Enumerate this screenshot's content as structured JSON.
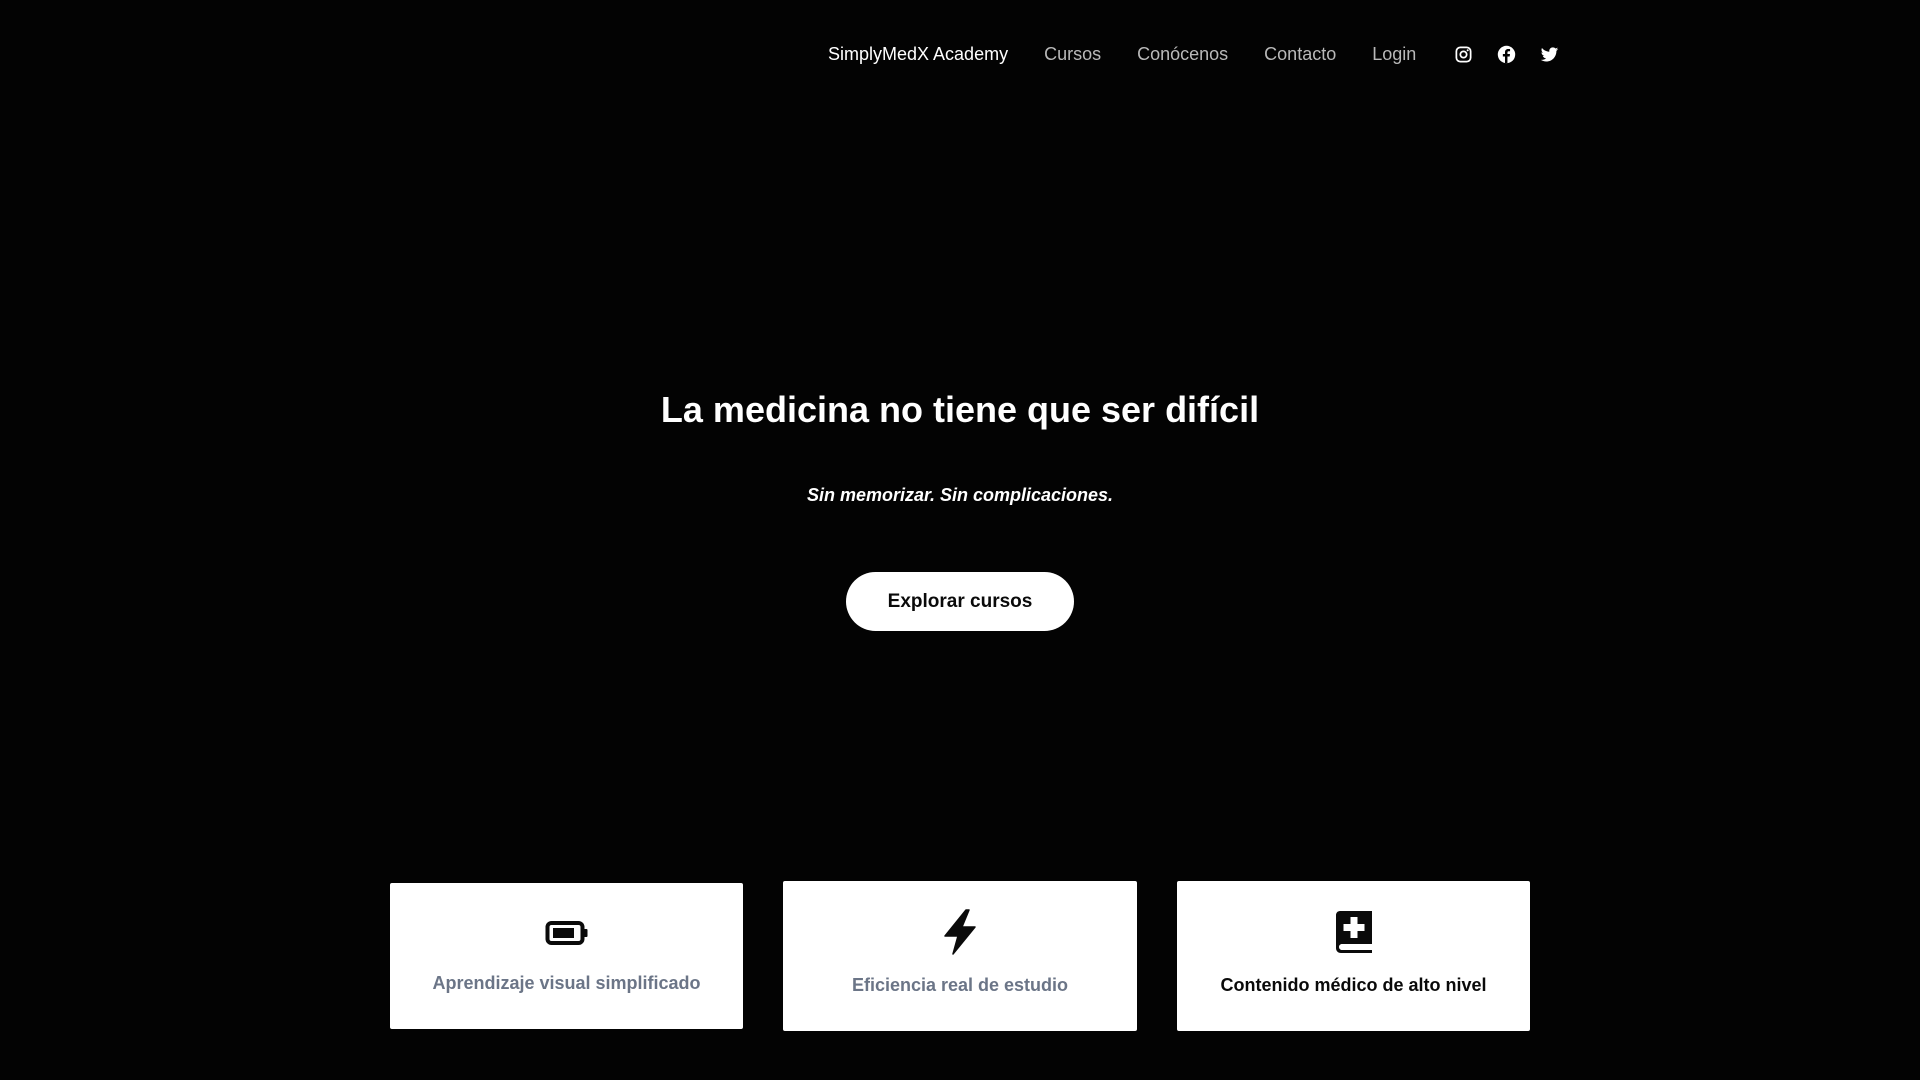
{
  "nav": {
    "brand": "SimplyMedX Academy",
    "links": [
      {
        "label": "Cursos"
      },
      {
        "label": "Conócenos"
      },
      {
        "label": "Contacto"
      },
      {
        "label": "Login"
      }
    ],
    "social_icons": [
      "instagram-icon",
      "facebook-icon",
      "twitter-icon"
    ]
  },
  "hero": {
    "title": "La medicina no tiene que ser difícil",
    "subtitle": "Sin memorizar. Sin complicaciones.",
    "cta_label": "Explorar cursos"
  },
  "features": [
    {
      "icon": "battery-icon",
      "label": "Aprendizaje visual simplificado"
    },
    {
      "icon": "lightning-bolt-icon",
      "label": "Eficiencia real de estudio"
    },
    {
      "icon": "medical-book-icon",
      "label": "Contenido médico de alto nivel"
    }
  ],
  "colors": {
    "background": "#030303",
    "nav_text": "#b9b9b9",
    "brand_text": "#ffffff",
    "card_background": "#ffffff",
    "card_label_muted": "#6b7587",
    "card_label_dark": "#0a0a0a"
  }
}
